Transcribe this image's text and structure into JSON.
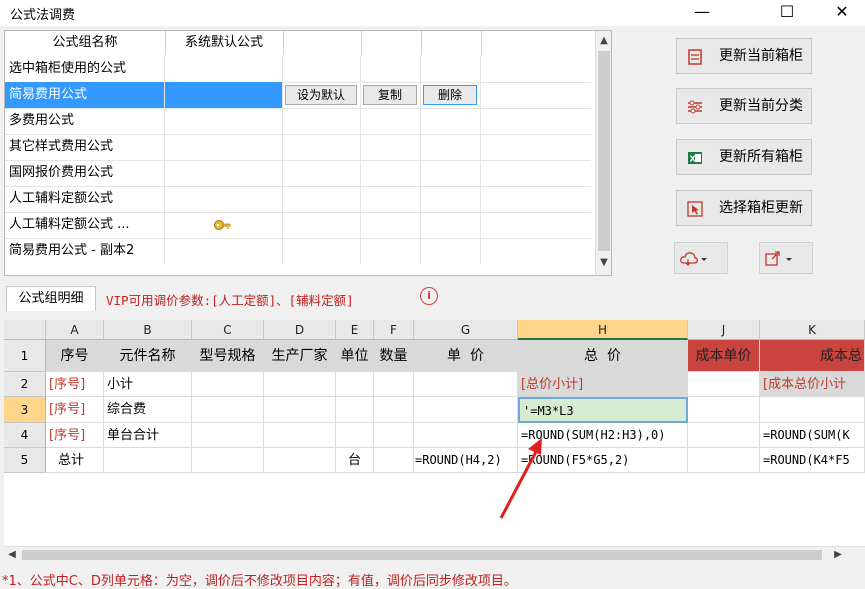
{
  "window": {
    "title": "公式法调费",
    "minimize": "—",
    "maximize": "☐",
    "close": "✕"
  },
  "groups": {
    "headers": [
      "公式组名称",
      "系统默认公式"
    ],
    "rows": [
      {
        "name": "选中箱柜使用的公式"
      },
      {
        "name": "简易费用公式",
        "selected": true
      },
      {
        "name": "多费用公式"
      },
      {
        "name": "其它样式费用公式"
      },
      {
        "name": "国网报价费用公式"
      },
      {
        "name": "人工辅料定额公式"
      },
      {
        "name": "人工辅料定额公式 ...",
        "default_icon": "key-icon"
      },
      {
        "name": "简易费用公式 - 副本2"
      }
    ],
    "row_buttons": {
      "set_default": "设为默认",
      "copy": "复制",
      "delete": "删除"
    }
  },
  "actions": {
    "update_current_cabinet": "更新当前箱柜",
    "update_current_category": "更新当前分类",
    "update_all_cabinets": "更新所有箱柜",
    "select_cabinet_update": "选择箱柜更新",
    "cloud_menu_icon": "cloud-icon",
    "export_menu_icon": "share-icon"
  },
  "detail": {
    "tab": "公式组明细",
    "vip_note": "VIP可用调价参数:[人工定额]、[辅料定额]",
    "info_icon": "i"
  },
  "sheet": {
    "col_letters": [
      "A",
      "B",
      "C",
      "D",
      "E",
      "F",
      "G",
      "H",
      "J",
      "K"
    ],
    "row_numbers": [
      "1",
      "2",
      "3",
      "4",
      "5"
    ],
    "header_row": [
      "序号",
      "元件名称",
      "型号规格",
      "生产厂家",
      "单位",
      "数量",
      "单  价",
      "总  价",
      "成本单价",
      "成本总"
    ],
    "rows": [
      {
        "a": "[序号]",
        "b": "小计",
        "h": "[总价小计]",
        "k": "[成本总价小计"
      },
      {
        "a": "[序号]",
        "b": "综合费",
        "h": "'=M3*L3"
      },
      {
        "a": "[序号]",
        "b": "单台合计",
        "h": "=ROUND(SUM(H2:H3),0)",
        "k": "=ROUND(SUM(K"
      },
      {
        "a": "总计",
        "e": "台",
        "g": "=ROUND(H4,2)",
        "h": "=ROUND(F5*G5,2)",
        "k": "=ROUND(K4*F5"
      }
    ],
    "selected_cell": "H3"
  },
  "footnote": "*1、公式中C、D列单元格：为空，调价后不修改项目内容；有值，调价后同步修改项目。",
  "colors": {
    "selection": "#3399ff",
    "header_red": "#c9433f",
    "note_red": "#c02020",
    "col_highlight": "#ffd58c"
  }
}
